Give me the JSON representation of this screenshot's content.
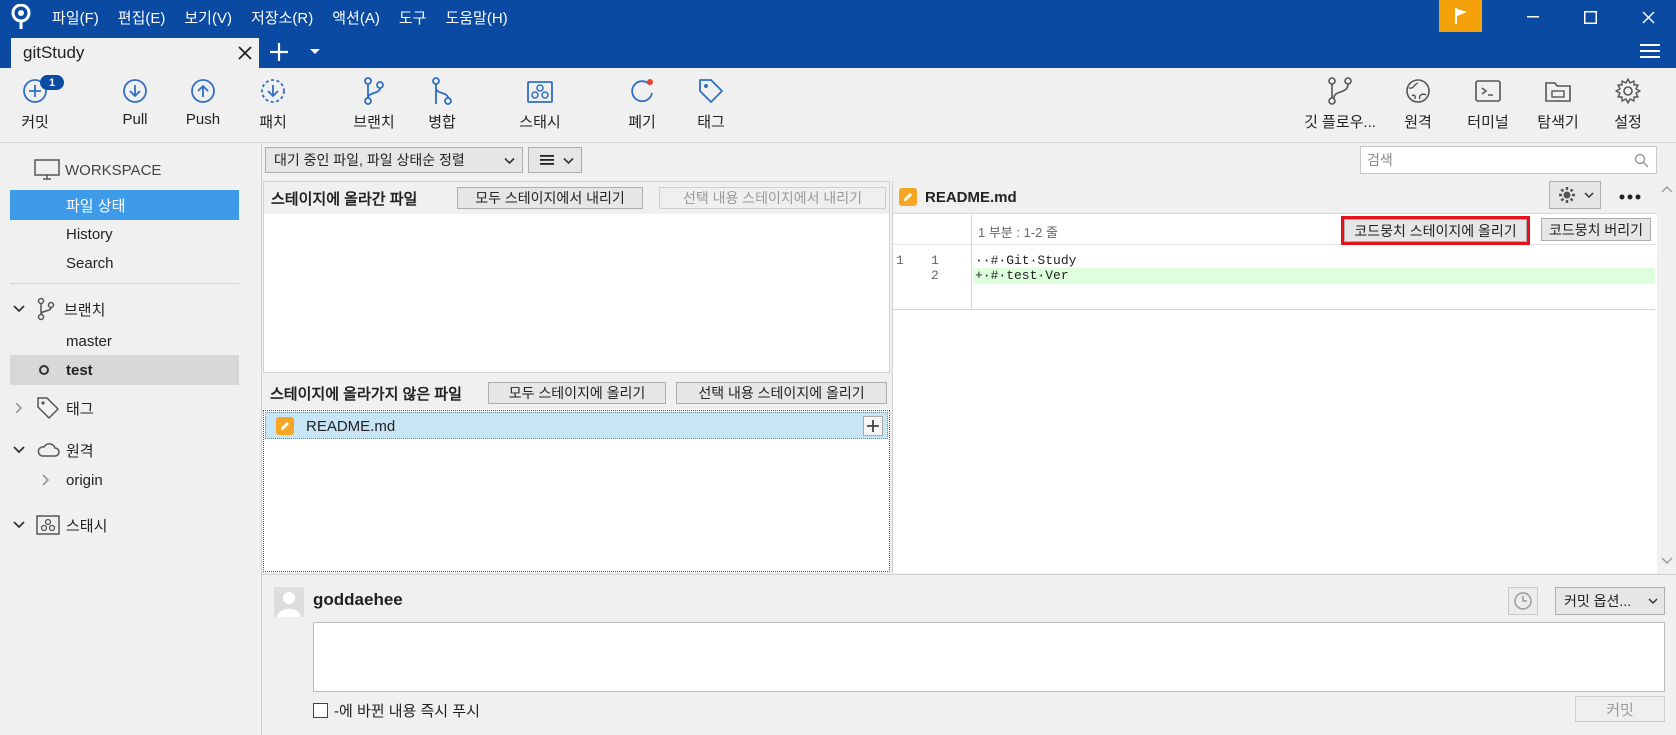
{
  "menu": {
    "items": [
      "파일(F)",
      "편집(E)",
      "보기(V)",
      "저장소(R)",
      "액션(A)",
      "도구",
      "도움말(H)"
    ]
  },
  "tab": {
    "title": "gitStudy"
  },
  "toolbar": {
    "commit": "커밋",
    "commit_badge": "1",
    "pull": "Pull",
    "push": "Push",
    "fetch": "패치",
    "branch": "브랜치",
    "merge": "병합",
    "stash": "스태시",
    "discard": "폐기",
    "tag": "태그",
    "gitflow": "깃 플로우...",
    "remote": "원격",
    "terminal": "터미널",
    "explorer": "탐색기",
    "settings": "설정"
  },
  "sidebar": {
    "workspace": "WORKSPACE",
    "workspace_items": [
      "파일 상태",
      "History",
      "Search"
    ],
    "branches_label": "브랜치",
    "branches": [
      "master",
      "test"
    ],
    "current_branch": "test",
    "tags_label": "태그",
    "remotes_label": "원격",
    "remotes": [
      "origin"
    ],
    "stashes_label": "스태시"
  },
  "filter": {
    "sort_label": "대기 중인 파일, 파일 상태순 정렬",
    "search_placeholder": "검색"
  },
  "staged": {
    "title": "스테이지에 올라간 파일",
    "unstage_all": "모두 스테이지에서 내리기",
    "unstage_selected": "선택 내용 스테이지에서 내리기"
  },
  "unstaged": {
    "title": "스테이지에 올라가지 않은 파일",
    "stage_all": "모두 스테이지에 올리기",
    "stage_selected": "선택 내용 스테이지에 올리기",
    "files": [
      {
        "name": "README.md"
      }
    ]
  },
  "diff": {
    "file": "README.md",
    "hunk_label": "1 부분 : 1-2 줄",
    "stage_hunk": "코드뭉치 스테이지에 올리기",
    "discard_hunk": "코드뭉치 버리기",
    "lines": [
      {
        "old": "1",
        "new": "1",
        "text": "··#·Git·Study",
        "type": "context"
      },
      {
        "old": "",
        "new": "2",
        "text": "+·#·test·Ver",
        "type": "added"
      }
    ]
  },
  "commit": {
    "author": "goddaehee",
    "options_label": "커밋 옵션...",
    "push_label": "-에 바뀐 내용 즉시 푸시",
    "commit_button": "커밋"
  },
  "colors": {
    "titlebar": "#0a4aa3",
    "accent_selected": "#3d9be9",
    "flag": "#f5a20a",
    "added_line": "#ddffdd",
    "highlight_box": "#e3121c",
    "file_modified": "#f5a623"
  }
}
